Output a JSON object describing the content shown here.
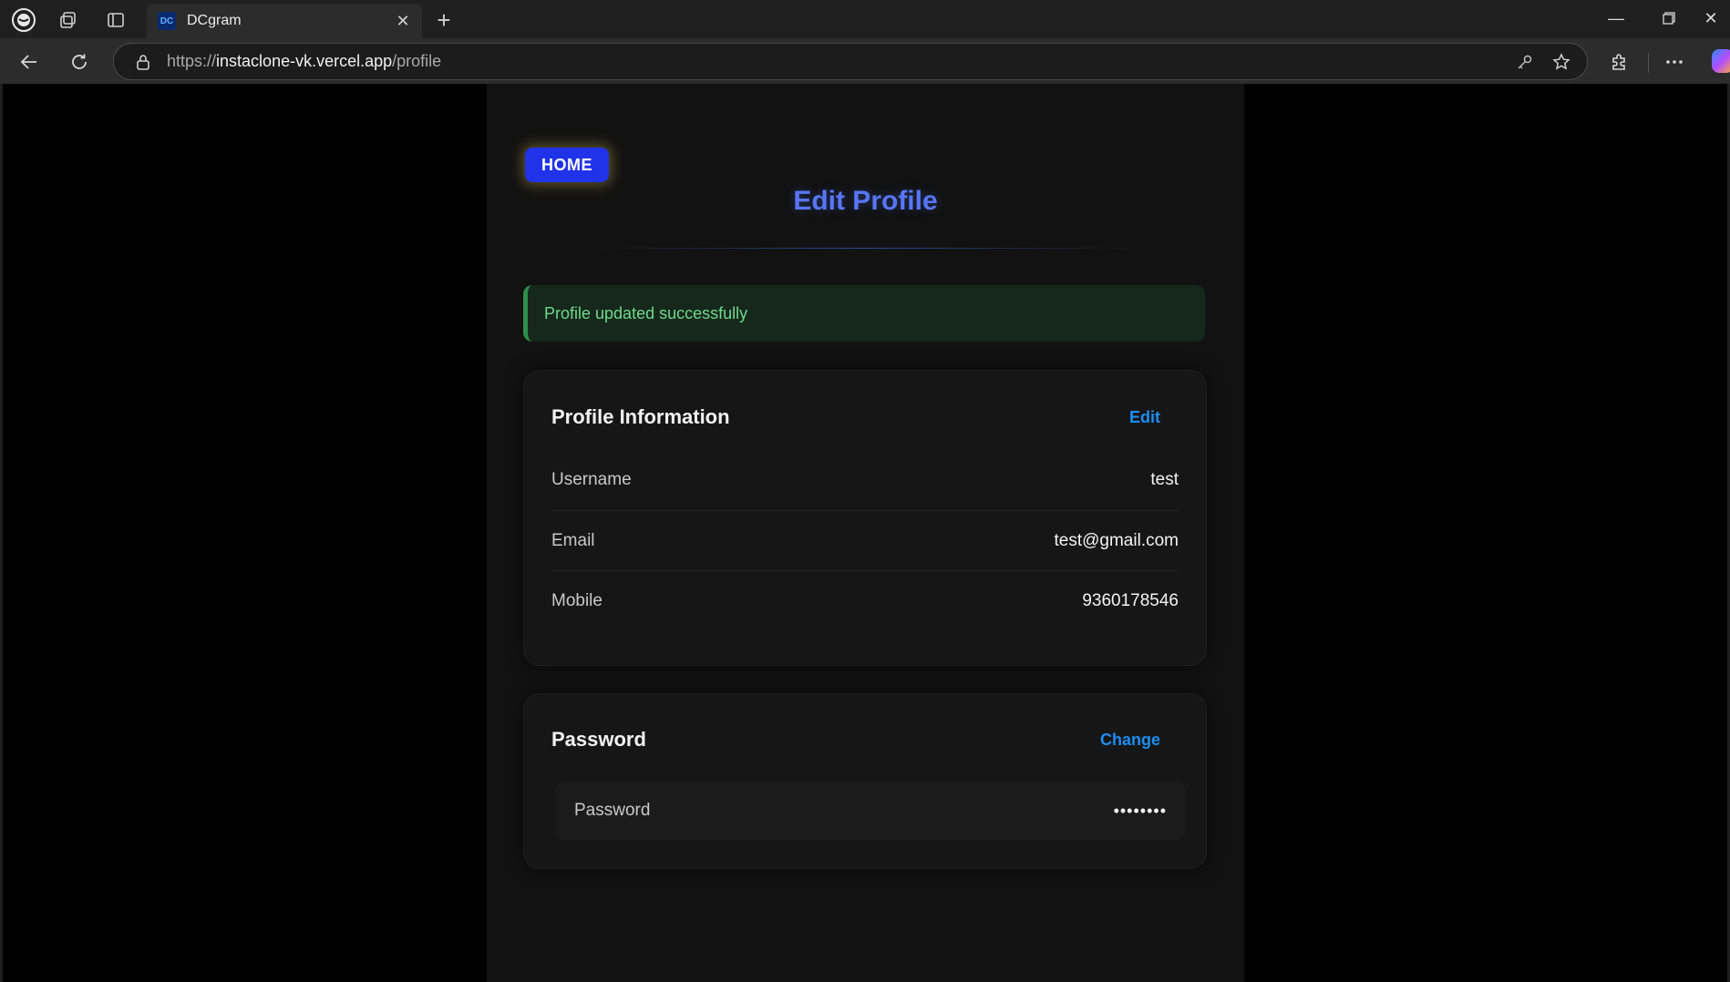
{
  "browser": {
    "tab_title": "DCgram",
    "tab_favicon_text": "DC",
    "url_prefix": "https://",
    "url_host": "instaclone-vk.vercel.app",
    "url_path": "/profile"
  },
  "page": {
    "home_label": "HOME",
    "title": "Edit Profile",
    "alert": "Profile updated successfully",
    "accent_color": "#2133e8",
    "link_color": "#1b8ef2",
    "success_color": "#6ed98c"
  },
  "profile_info": {
    "title": "Profile Information",
    "action": "Edit",
    "rows": [
      {
        "label": "Username",
        "value": "test"
      },
      {
        "label": "Email",
        "value": "test@gmail.com"
      },
      {
        "label": "Mobile",
        "value": "9360178546"
      }
    ]
  },
  "password": {
    "title": "Password",
    "action": "Change",
    "label": "Password",
    "value": "••••••••"
  }
}
